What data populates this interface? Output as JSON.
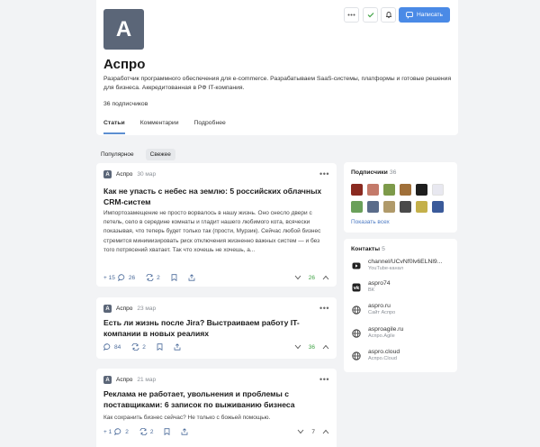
{
  "profile": {
    "avatar_letter": "А",
    "title": "Аспро",
    "description": "Разработчик программного обеспечения для e-commerce. Разрабатываем SaaS-системы, платформы и готовые решения для бизнеса. Аккредитованная в РФ IT-компания.",
    "subscribers": "36 подписчиков",
    "write_label": "Написать",
    "tabs": [
      "Статьи",
      "Комментарии",
      "Подробнее"
    ]
  },
  "filters": {
    "popular": "Популярное",
    "fresh": "Свежее"
  },
  "articles": [
    {
      "author": "Аспро",
      "date": "30 мар",
      "title": "Как не упасть с небес на землю: 5 российских облачных CRM-систем",
      "text": "Импортозамещение не просто ворвалось в нашу жизнь. Оно снесло двери с петель, село в середине комнаты и гладит нашего любимого кота, всячески показывая, что теперь будет только так (прости, Мурзик). Сейчас любой бизнес стремится минимизировать риск отключения жизненно важных систем — и без того потрясений хватает. Так что хочешь не хочешь, а...",
      "rating": "+ 15",
      "comments": "26",
      "reposts": "2",
      "votes": "26"
    },
    {
      "author": "Аспро",
      "date": "23 мар",
      "title": "Есть ли жизнь после Jira? Выстраиваем работу IT-компании в новых реалиях",
      "comments": "84",
      "reposts": "2",
      "votes": "36"
    },
    {
      "author": "Аспро",
      "date": "21 мар",
      "title": "Реклама не работает, увольнения и проблемы с поставщиками: 6 записок по выживанию бизнеса",
      "text": "Как сохранить бизнес сейчас? Не только с божьей помощью.",
      "rating": "+ 1",
      "comments": "2",
      "reposts": "2",
      "votes": "7"
    }
  ],
  "sidebar": {
    "subscribers_title": "Подписчики",
    "subscribers_count": "36",
    "show_all": "Показать всех",
    "contacts_title": "Контакты",
    "contacts_count": "5",
    "contacts": [
      {
        "main": "channel/UCvNf0lv6ELNl9...",
        "sub": "YouTube-канал",
        "icon": "youtube-icon"
      },
      {
        "main": "aspro74",
        "sub": "ВК",
        "icon": "vk-icon"
      },
      {
        "main": "aspro.ru",
        "sub": "Сайт Аспро",
        "icon": "globe-icon"
      },
      {
        "main": "asproagile.ru",
        "sub": "Аспро.Agile",
        "icon": "globe-icon"
      },
      {
        "main": "aspro.cloud",
        "sub": "Аспро.Cloud",
        "icon": "globe-icon"
      }
    ]
  },
  "colors": {
    "accent": "#4a8ae6",
    "avatar_bg": "#5b6678",
    "positive": "#3fa244",
    "link": "#4a78c2"
  }
}
